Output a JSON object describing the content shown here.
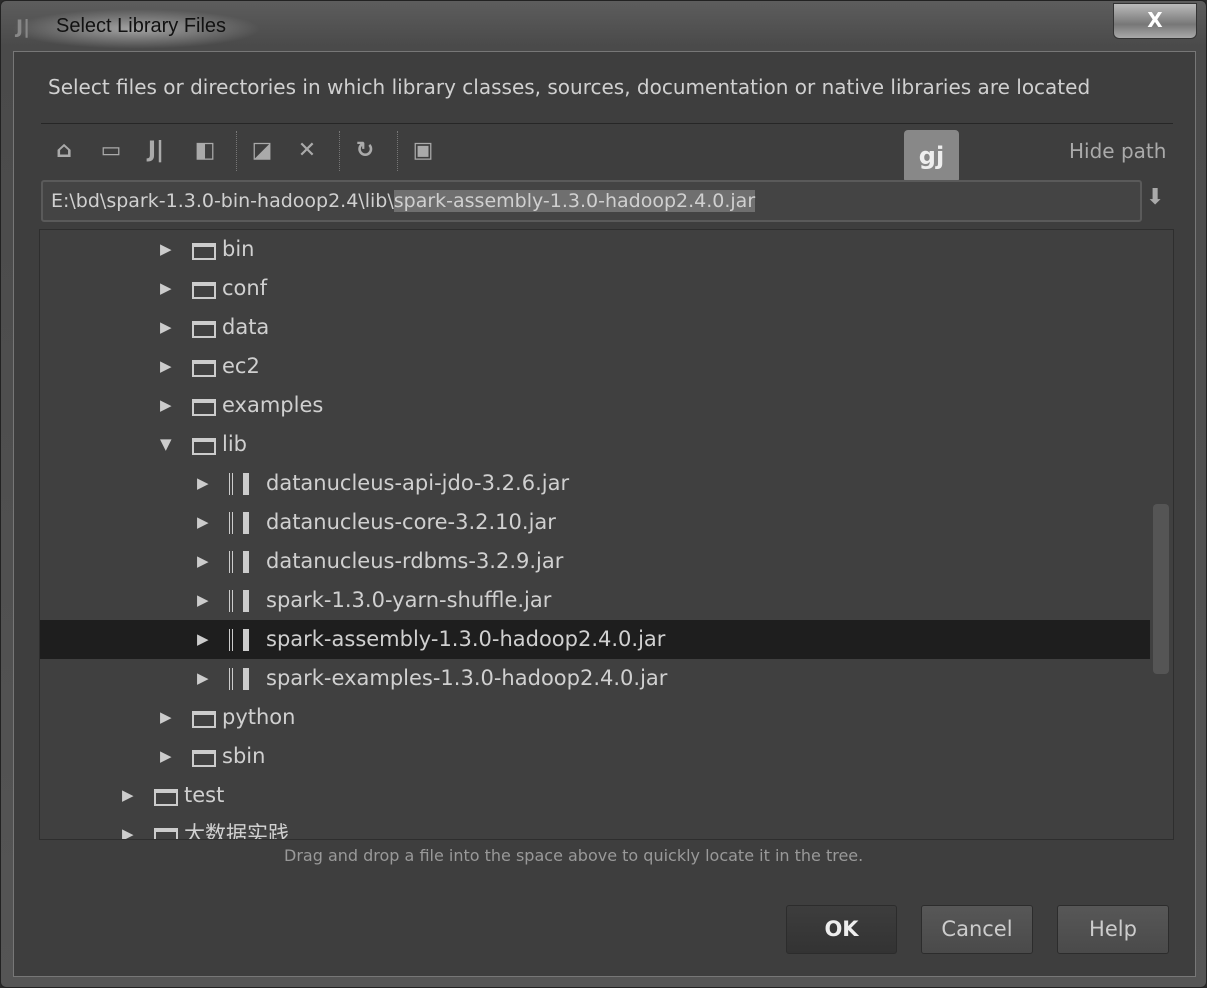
{
  "window": {
    "title": "Select Library Files",
    "app_icon": "intellij-icon",
    "close_label": "X"
  },
  "description": "Select files or directories in which library classes, sources, documentation or native libraries are located",
  "toolbar": {
    "icons": [
      "home-icon",
      "desktop-icon",
      "project-icon",
      "module-icon",
      "new-folder-icon",
      "delete-icon",
      "refresh-icon",
      "show-hidden-icon"
    ],
    "hide_path": "Hide path",
    "badge": "gj"
  },
  "path": {
    "prefix": "E:\\bd\\spark-1.3.0-bin-hadoop2.4\\lib\\",
    "selected": "spark-assembly-1.3.0-hadoop2.4.0.jar"
  },
  "tree": [
    {
      "label": "bin",
      "type": "folder",
      "level": 2,
      "expanded": false
    },
    {
      "label": "conf",
      "type": "folder",
      "level": 2,
      "expanded": false
    },
    {
      "label": "data",
      "type": "folder",
      "level": 2,
      "expanded": false
    },
    {
      "label": "ec2",
      "type": "folder",
      "level": 2,
      "expanded": false
    },
    {
      "label": "examples",
      "type": "folder",
      "level": 2,
      "expanded": false
    },
    {
      "label": "lib",
      "type": "folder",
      "level": 2,
      "expanded": true
    },
    {
      "label": "datanucleus-api-jdo-3.2.6.jar",
      "type": "jar",
      "level": 3
    },
    {
      "label": "datanucleus-core-3.2.10.jar",
      "type": "jar",
      "level": 3
    },
    {
      "label": "datanucleus-rdbms-3.2.9.jar",
      "type": "jar",
      "level": 3
    },
    {
      "label": "spark-1.3.0-yarn-shuffle.jar",
      "type": "jar",
      "level": 3
    },
    {
      "label": "spark-assembly-1.3.0-hadoop2.4.0.jar",
      "type": "jar",
      "level": 3,
      "selected": true
    },
    {
      "label": "spark-examples-1.3.0-hadoop2.4.0.jar",
      "type": "jar",
      "level": 3
    },
    {
      "label": "python",
      "type": "folder",
      "level": 2,
      "expanded": false
    },
    {
      "label": "sbin",
      "type": "folder",
      "level": 2,
      "expanded": false
    },
    {
      "label": "test",
      "type": "folder",
      "level": 1,
      "expanded": false
    },
    {
      "label": "大数据实践",
      "type": "folder",
      "level": 1,
      "expanded": false
    }
  ],
  "hint": "Drag and drop a file into the space above to quickly locate it in the tree.",
  "buttons": {
    "ok": "OK",
    "cancel": "Cancel",
    "help": "Help"
  }
}
